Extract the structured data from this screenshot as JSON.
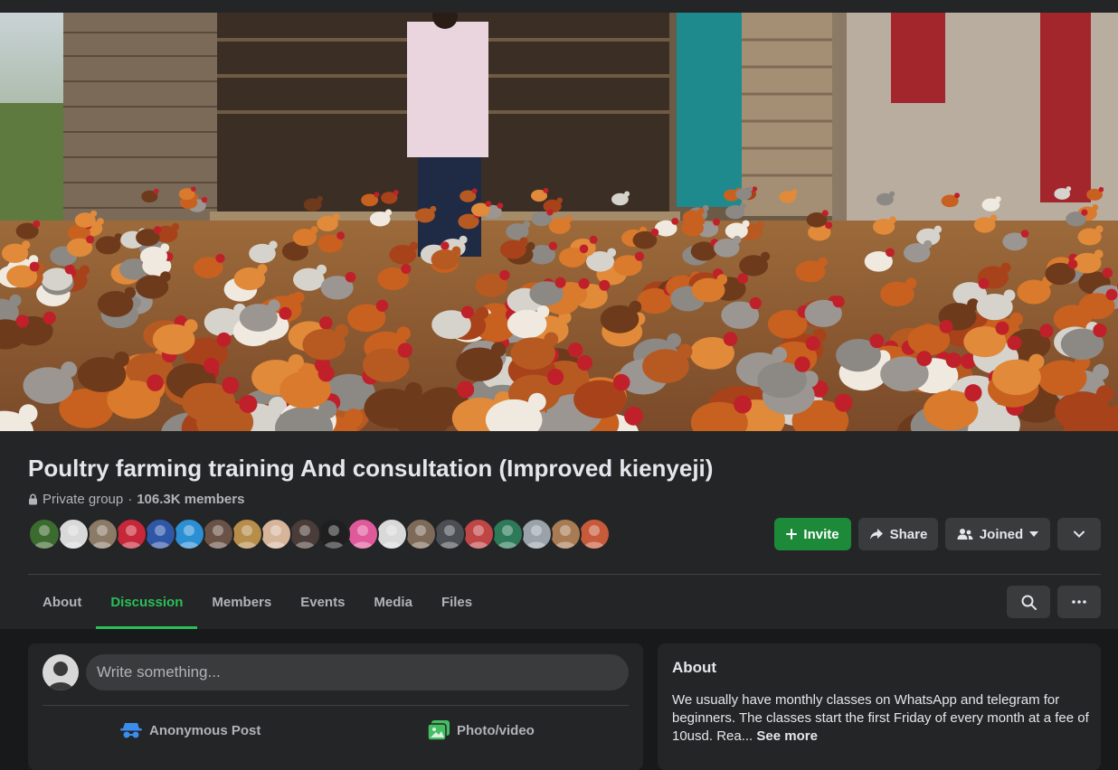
{
  "group": {
    "title": "Poultry farming training And consultation (Improved kienyeji)",
    "privacy": "Private group",
    "separator": "·",
    "members": "106.3K members"
  },
  "member_avatars": [
    "#3b6b2f",
    "#d9d9d9",
    "#8a7a66",
    "#c6283a",
    "#2f57a8",
    "#2d8fd3",
    "#6a5346",
    "#b78d4a",
    "#d7b59b",
    "#4a3c38",
    "#1f1f1f",
    "#e05a9b",
    "#d9d9d9",
    "#7e6a58",
    "#4b4f54",
    "#c04545",
    "#2d7a59",
    "#9aa3aa",
    "#a97b55",
    "#c75a3a"
  ],
  "actions": {
    "invite": "Invite",
    "share": "Share",
    "joined": "Joined"
  },
  "tabs": [
    {
      "label": "About",
      "active": false
    },
    {
      "label": "Discussion",
      "active": true
    },
    {
      "label": "Members",
      "active": false
    },
    {
      "label": "Events",
      "active": false
    },
    {
      "label": "Media",
      "active": false
    },
    {
      "label": "Files",
      "active": false
    }
  ],
  "composer": {
    "placeholder": "Write something...",
    "anonymous_label": "Anonymous Post",
    "photo_label": "Photo/video"
  },
  "about": {
    "title": "About",
    "body": "We usually have monthly classes on WhatsApp and telegram for beginners. The classes start the first Friday of every month at a fee of 10usd. Rea...",
    "see_more": "See more"
  },
  "colors": {
    "accent_green": "#2abf57",
    "invite_green": "#1d8a39",
    "surface": "#242526",
    "background": "#18191a"
  },
  "icons": {
    "lock": "lock-icon",
    "plus": "plus-icon",
    "share": "share-arrow-icon",
    "joined": "people-icon",
    "caret": "caret-down-icon",
    "chevron": "chevron-down-icon",
    "search": "search-icon",
    "more": "more-dots-icon",
    "anonymous": "anonymous-icon",
    "photo": "photo-icon"
  }
}
